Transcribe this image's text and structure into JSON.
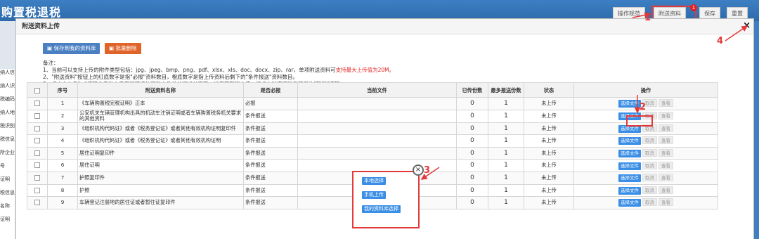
{
  "app": {
    "title": "购置税退税",
    "buttons": [
      "操作规范",
      "附送资料",
      "保存",
      "重置"
    ],
    "attach_badge": "1",
    "sidebar": [
      "纳人信",
      "纳人识",
      "税编码",
      "纳人地",
      "税识别",
      "税信息",
      "所企业",
      "号",
      "证明",
      "税信息",
      "名称",
      "证明"
    ]
  },
  "modal": {
    "title": "附送资料上传",
    "close": "×",
    "save_button": "保存到我的资料库",
    "delete_button": "批量删除",
    "notes": {
      "label": "备注：",
      "line1_a": "1、当前可以支持上传的附件类型包括：jpg、jpeg、bmp、png、pdf、xlsx、xls、doc、docx、zip、rar，单项附送资料可",
      "line1_b": "支持最大上传值为20M。",
      "line2": "2、\"附送资料\"按钮上的红底数字是指\"必报\"资料数目，橙底数字是指上传资料后剩下的\"条件报送\"资料数目。",
      "line3": "3、点击右上角\"×\"按钮会自动上传您所选择的资料文件并关闭当前页面，如您要取消上传，请点击对应资料名称后的\"取消\"按钮。"
    },
    "table": {
      "headers": [
        "",
        "序号",
        "附送资料名称",
        "是否必报",
        "当前文件",
        "已传份数",
        "最多报送份数",
        "状态",
        "操作"
      ],
      "rows": [
        {
          "no": "1",
          "name": "《车辆购置税完税证明》正本",
          "req": "必报",
          "uploaded": "0",
          "max": "1",
          "status": "未上传"
        },
        {
          "no": "2",
          "name": "公安机关车辆管理机构出具的机动车注销证明或者车辆购置税务机关要求的其他资料",
          "req": "条件报送",
          "uploaded": "0",
          "max": "1",
          "status": "未上传"
        },
        {
          "no": "3",
          "name": "《组织机构代码证》或者《税务登记证》或者其他有效机构证明复印件",
          "req": "条件报送",
          "uploaded": "0",
          "max": "1",
          "status": "未上传"
        },
        {
          "no": "4",
          "name": "《组织机构代码证》或者《税务登记证》或者其他有效机构证明",
          "req": "条件报送",
          "uploaded": "0",
          "max": "1",
          "status": "未上传"
        },
        {
          "no": "5",
          "name": "居住证明复印件",
          "req": "条件报送",
          "uploaded": "0",
          "max": "1",
          "status": "未上传"
        },
        {
          "no": "6",
          "name": "居住证明",
          "req": "条件报送",
          "uploaded": "0",
          "max": "1",
          "status": "未上传"
        },
        {
          "no": "7",
          "name": "护照复印件",
          "req": "条件报送",
          "uploaded": "0",
          "max": "1",
          "status": "未上传"
        },
        {
          "no": "8",
          "name": "护照",
          "req": "条件报送",
          "uploaded": "0",
          "max": "1",
          "status": "未上传"
        },
        {
          "no": "9",
          "name": "车辆登记注册地的居住证或者暂住证复印件",
          "req": "条件报送",
          "uploaded": "0",
          "max": "1",
          "status": "未上传"
        }
      ],
      "actions": {
        "select": "选择文件",
        "cancel": "取消",
        "view": "查看"
      }
    },
    "popup": {
      "options": [
        "本地选择",
        "手机上传",
        "我的资料库选择"
      ]
    }
  },
  "annotations": [
    "1",
    "2",
    "3",
    "4"
  ],
  "colors": {
    "annotation": "#e23a3a",
    "primary": "#3a8ee6",
    "header": "#2d6aa9"
  }
}
